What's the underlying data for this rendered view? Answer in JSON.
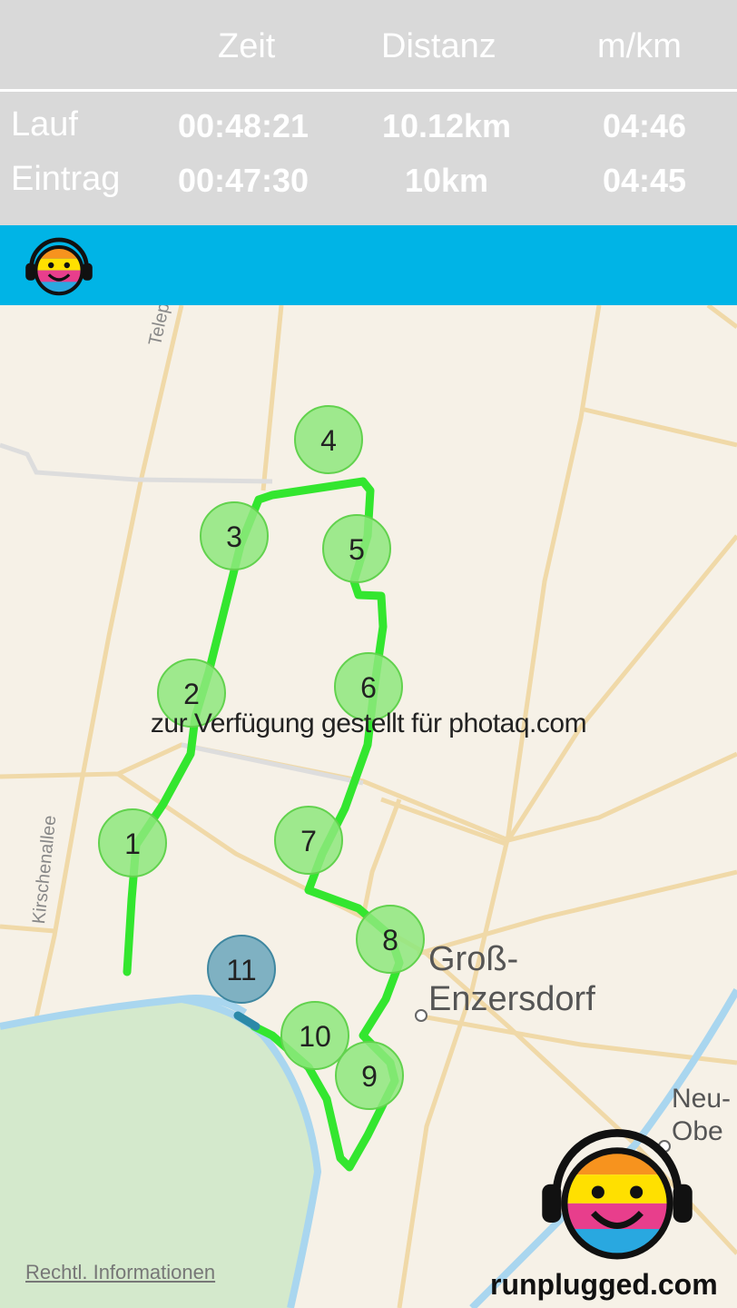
{
  "header": {
    "columns": [
      "Zeit",
      "Distanz",
      "m/km"
    ],
    "rows": [
      {
        "label": "Lauf",
        "zeit": "00:48:21",
        "distanz": "10.12km",
        "pace": "04:46"
      },
      {
        "label": "Eintrag",
        "zeit": "00:47:30",
        "distanz": "10km",
        "pace": "04:45"
      }
    ]
  },
  "map": {
    "km_markers": [
      "1",
      "2",
      "3",
      "4",
      "5",
      "6",
      "7",
      "8",
      "9",
      "10",
      "11"
    ],
    "places": {
      "town_line1": "Groß-",
      "town_line2": "Enzersdorf",
      "neu_line1": "Neu-",
      "neu_line2": "Obe"
    },
    "road_labels": {
      "telephon": "Telephon",
      "kirschenallee": "Kirschenallee"
    },
    "watermark": "zur Verfügung gestellt für photaq.com",
    "legal": "Rechtl. Informationen",
    "brand": "runplugged.com"
  },
  "colors": {
    "route": "#33e62f",
    "marker": "#8ee87c",
    "marker_last": "#7fb1c2",
    "bar": "#00b4e6",
    "header_bg": "#d9d9d9"
  },
  "icons": {
    "logo": "smiley-headphones-icon"
  }
}
